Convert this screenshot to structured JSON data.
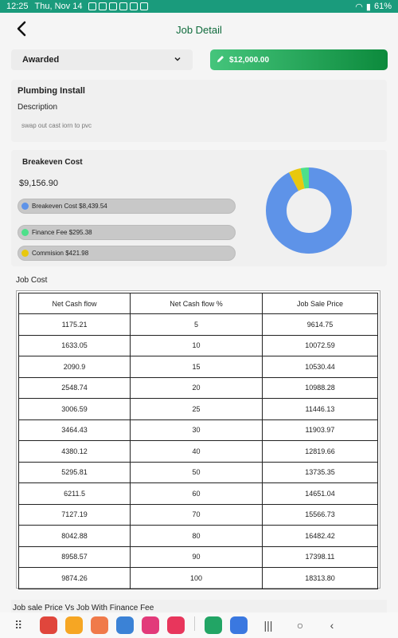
{
  "status_bar": {
    "time": "12:25",
    "date": "Thu, Nov 14",
    "battery": "61%"
  },
  "header": {
    "title": "Job Detail"
  },
  "status_select": {
    "value": "Awarded"
  },
  "price_button": {
    "label": "$12,000.00"
  },
  "job": {
    "title": "Plumbing Install",
    "description_label": "Description",
    "description": "swap out cast iorn to pvc"
  },
  "breakeven": {
    "title": "Breakeven Cost",
    "total": "$9,156.90",
    "items": [
      {
        "label": "Breakeven Cost $8,439.54",
        "value": 8439.54,
        "color": "#5e93e8"
      },
      {
        "label": "Finance Fee $295.38",
        "value": 295.38,
        "color": "#4ee08a"
      },
      {
        "label": "Commision $421.98",
        "value": 421.98,
        "color": "#e8c80e"
      }
    ]
  },
  "job_cost": {
    "label": "Job Cost",
    "headers": [
      "Net Cash flow",
      "Net Cash flow %",
      "Job Sale Price"
    ],
    "rows": [
      [
        "1175.21",
        "5",
        "9614.75"
      ],
      [
        "1633.05",
        "10",
        "10072.59"
      ],
      [
        "2090.9",
        "15",
        "10530.44"
      ],
      [
        "2548.74",
        "20",
        "10988.28"
      ],
      [
        "3006.59",
        "25",
        "11446.13"
      ],
      [
        "3464.43",
        "30",
        "11903.97"
      ],
      [
        "4380.12",
        "40",
        "12819.66"
      ],
      [
        "5295.81",
        "50",
        "13735.35"
      ],
      [
        "6211.5",
        "60",
        "14651.04"
      ],
      [
        "7127.19",
        "70",
        "15566.73"
      ],
      [
        "8042.88",
        "80",
        "16482.42"
      ],
      [
        "8958.57",
        "90",
        "17398.11"
      ],
      [
        "9874.26",
        "100",
        "18313.80"
      ]
    ]
  },
  "next_section": {
    "label": "Job sale Price Vs Job With Finance Fee"
  },
  "navbar": {
    "apps": [
      {
        "icon": "notes-app-icon",
        "color": "#e0463c"
      },
      {
        "icon": "files-app-icon",
        "color": "#f6a623"
      },
      {
        "icon": "contacts-app-icon",
        "color": "#f07a4a"
      },
      {
        "icon": "chrome-app-icon",
        "color": "#3b82d6"
      },
      {
        "icon": "flower-app-icon",
        "color": "#e23a7a"
      },
      {
        "icon": "camera-app-icon",
        "color": "#e8365c"
      },
      {
        "icon": "meet-app-icon",
        "color": "#22a565"
      },
      {
        "icon": "calendar-app-icon",
        "color": "#3a78e0"
      }
    ],
    "calendar_badge": "2"
  }
}
